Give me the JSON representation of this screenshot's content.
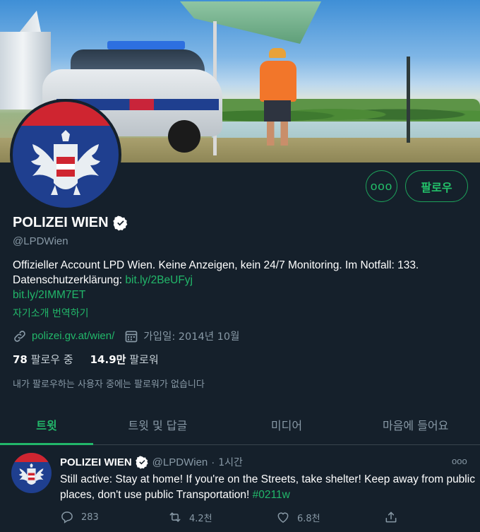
{
  "profile": {
    "display_name": "POLIZEI WIEN",
    "handle": "@LPDWien",
    "bio_text": "Offizieller Account LPD Wien. Keine Anzeigen, kein 24/7 Monitoring. Im Notfall: 133. Datenschutzerklärung: ",
    "bio_link_1": "bit.ly/2BeUFyj",
    "bio_link_2": "bit.ly/2IMM7ET",
    "translate_label": "자기소개 번역하기",
    "website": "polizei.gv.at/wien/",
    "joined": "가입일: 2014년 10월",
    "following_count": "78",
    "following_label": "팔로우 중",
    "followers_count": "14.9만",
    "followers_label": "팔로워",
    "followers_note": "내가 팔로우하는 사용자 중에는 팔로워가 없습니다",
    "follow_button": "팔로우",
    "more_button": "ooo"
  },
  "tabs": [
    {
      "label": "트윗",
      "active": true
    },
    {
      "label": "트윗 및 답글",
      "active": false
    },
    {
      "label": "미디어",
      "active": false
    },
    {
      "label": "마음에 들어요",
      "active": false
    }
  ],
  "tweet": {
    "name": "POLIZEI WIEN",
    "handle": "@LPDWien",
    "separator": "·",
    "time": "1시간",
    "more": "ooo",
    "text": "Still active: Stay at home! If you're on the Streets, take shelter! Keep away from public places, don't use public Transportation! ",
    "hashtag": "#0211w",
    "replies": "283",
    "retweets": "4.2천",
    "likes": "6.8천"
  },
  "colors": {
    "background": "#15202b",
    "accent": "#22b76a",
    "muted": "#8899a6"
  },
  "icons": [
    "verified-badge-icon",
    "link-icon",
    "calendar-icon",
    "reply-icon",
    "retweet-icon",
    "like-icon",
    "share-icon",
    "more-icon"
  ]
}
